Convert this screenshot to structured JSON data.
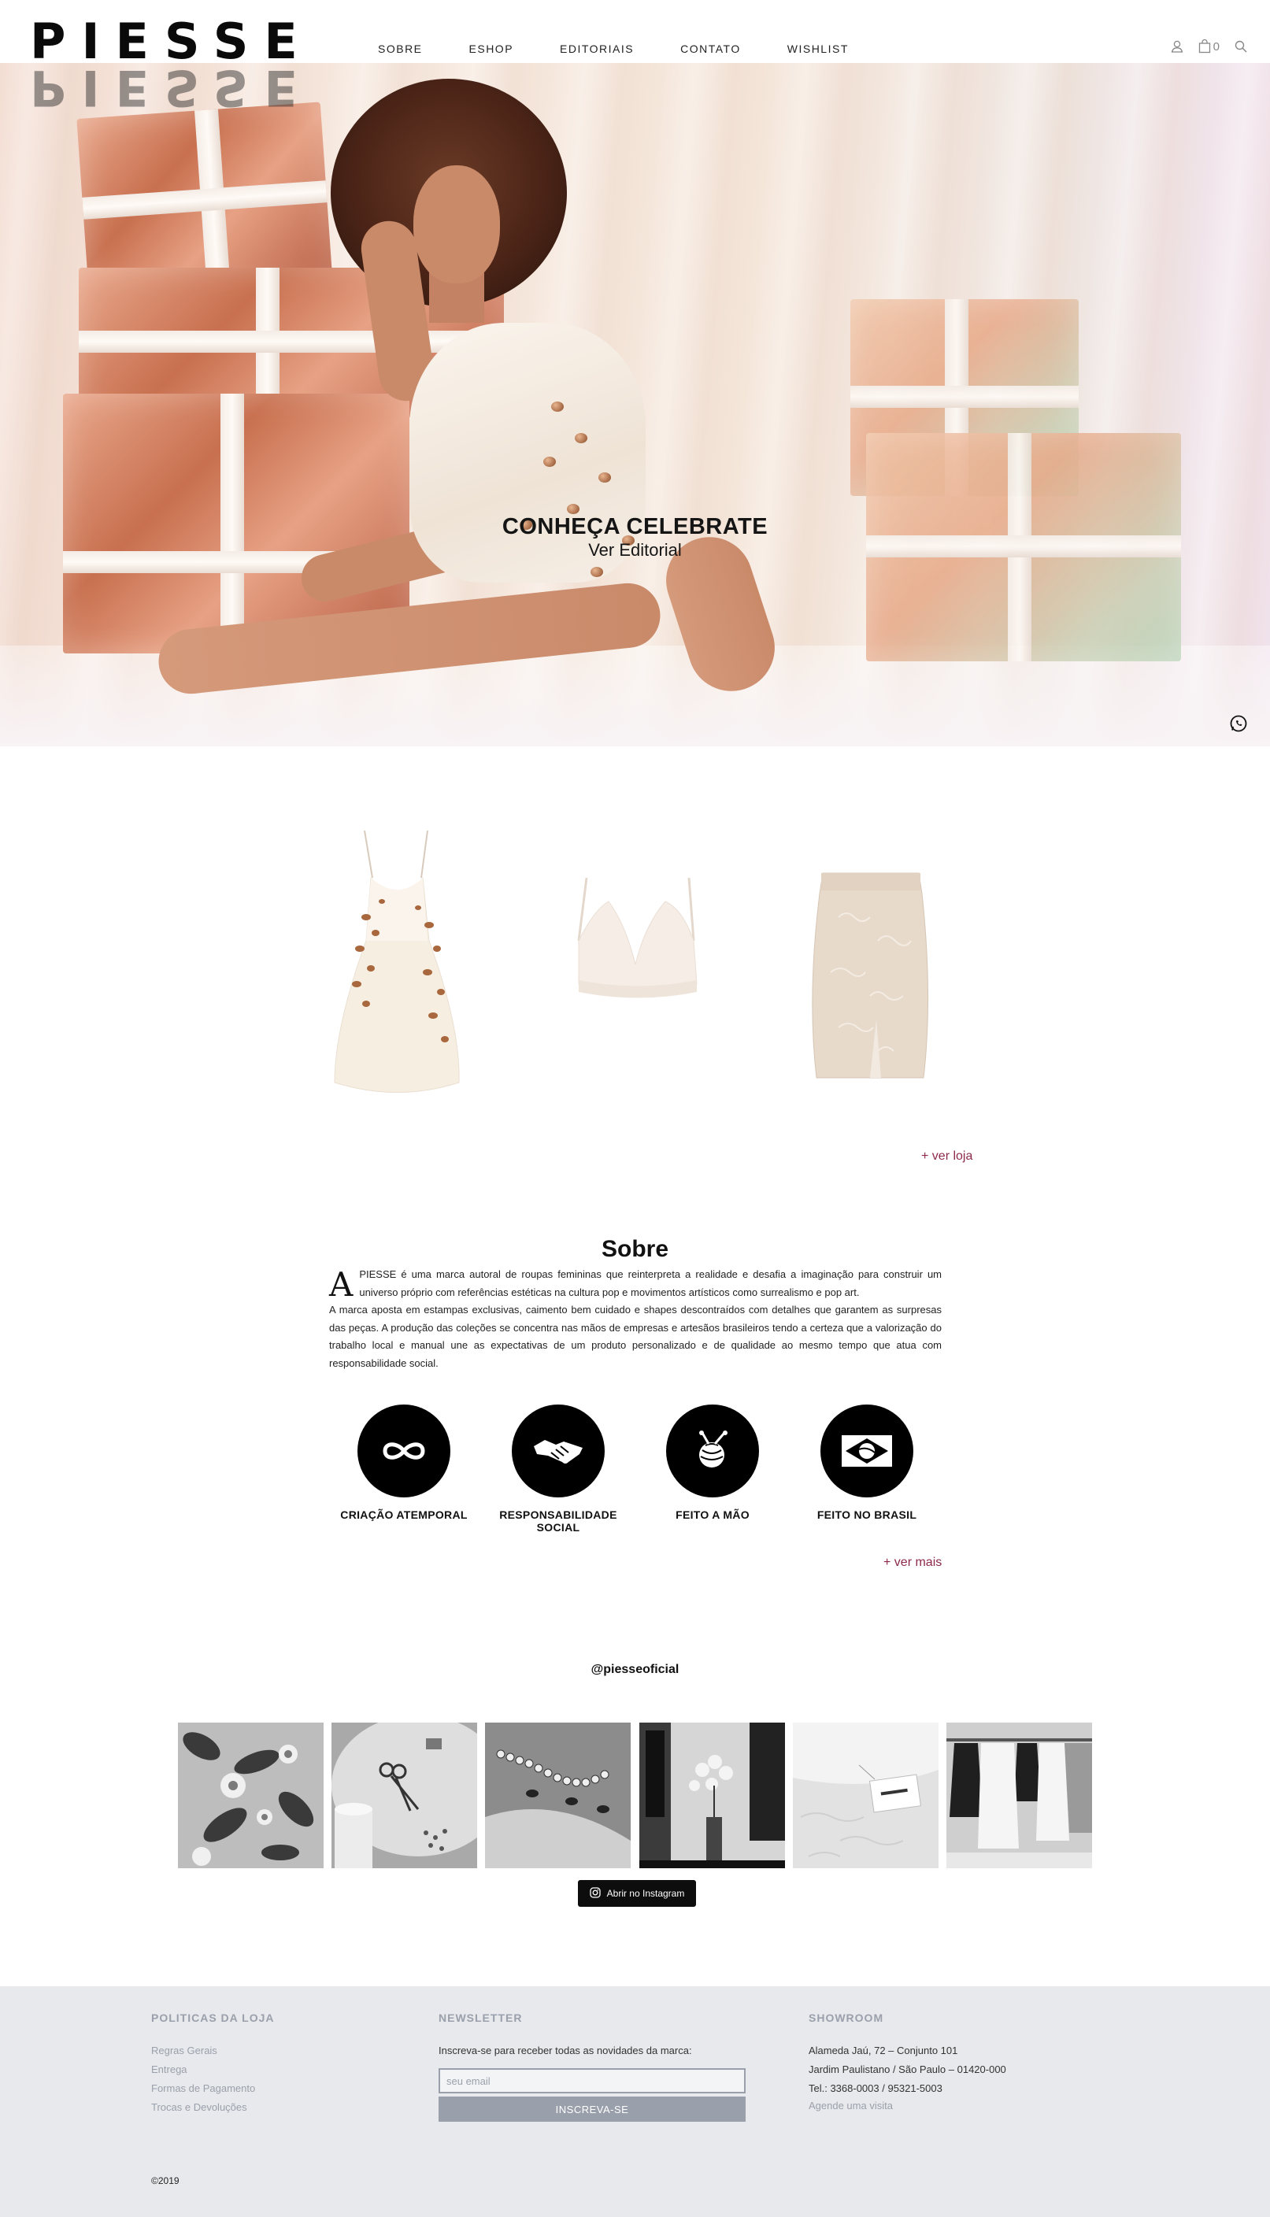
{
  "header": {
    "logo": "PIESSE",
    "nav": [
      "SOBRE",
      "ESHOP",
      "EDITORIAIS",
      "CONTATO",
      "WISHLIST"
    ],
    "cart_count": "0",
    "icons": [
      "user-icon",
      "bag-icon",
      "search-icon"
    ]
  },
  "hero": {
    "title": "CONHEÇA CELEBRATE",
    "subtitle": "Ver Editorial",
    "whatsapp_icon": "whatsapp-icon"
  },
  "products": {
    "items": [
      "sequin-slip-dress",
      "satin-bralette-top",
      "lace-pencil-skirt"
    ],
    "more_link": "+ ver loja"
  },
  "about": {
    "title": "Sobre",
    "dropcap": "A",
    "paragraph1": "PIESSE é uma marca autoral de roupas femininas que reinterpreta a realidade e desafia a imaginação para construir um universo próprio com referências estéticas na cultura pop e movimentos artísticos como surrealismo e pop art.",
    "paragraph2": "A marca aposta em estampas exclusivas, caimento bem cuidado e shapes descontraídos com detalhes que garantem as surpresas das peças. A produção das coleções se concentra nas mãos de empresas e artesãos brasileiros tendo a certeza que a valorização do trabalho local e manual une as expectativas de um produto personalizado e de qualidade ao mesmo tempo que atua com responsabilidade social.",
    "features": [
      {
        "label": "CRIAÇÃO ATEMPORAL",
        "icon": "infinity-icon"
      },
      {
        "label": "RESPONSABILIDADE SOCIAL",
        "icon": "handshake-icon"
      },
      {
        "label": "FEITO A MÃO",
        "icon": "yarn-icon"
      },
      {
        "label": "FEITO NO BRASIL",
        "icon": "brazil-flag-icon"
      }
    ],
    "more_link": "+ ver mais"
  },
  "instagram": {
    "handle": "@piesseoficial",
    "tiles": [
      "floral-print-photo",
      "sewing-tools-photo",
      "pearl-necklace-photo",
      "showroom-orchid-photo",
      "garment-tag-photo",
      "clothing-rack-photo"
    ],
    "button": "Abrir no Instagram"
  },
  "footer": {
    "policies_title": "POLITICAS DA LOJA",
    "policies": [
      "Regras Gerais",
      "Entrega",
      "Formas de Pagamento",
      "Trocas e Devoluções"
    ],
    "newsletter_title": "NEWSLETTER",
    "newsletter_text": "Inscreva-se para receber todas as novidades da marca:",
    "newsletter_placeholder": "seu email",
    "newsletter_button": "INSCREVA-SE",
    "showroom_title": "SHOWROOM",
    "address1": "Alameda Jaú, 72 – Conjunto 101",
    "address2": "Jardim Paulistano / São Paulo – 01420-000",
    "phone": "Tel.: 3368-0003 / 95321-5003",
    "visit": "Agende uma visita",
    "copyright": "©2019"
  },
  "colors": {
    "accent_link": "#8d2a4a",
    "footer_bg": "#e8e9ec",
    "footer_muted": "#9aa0ab"
  }
}
